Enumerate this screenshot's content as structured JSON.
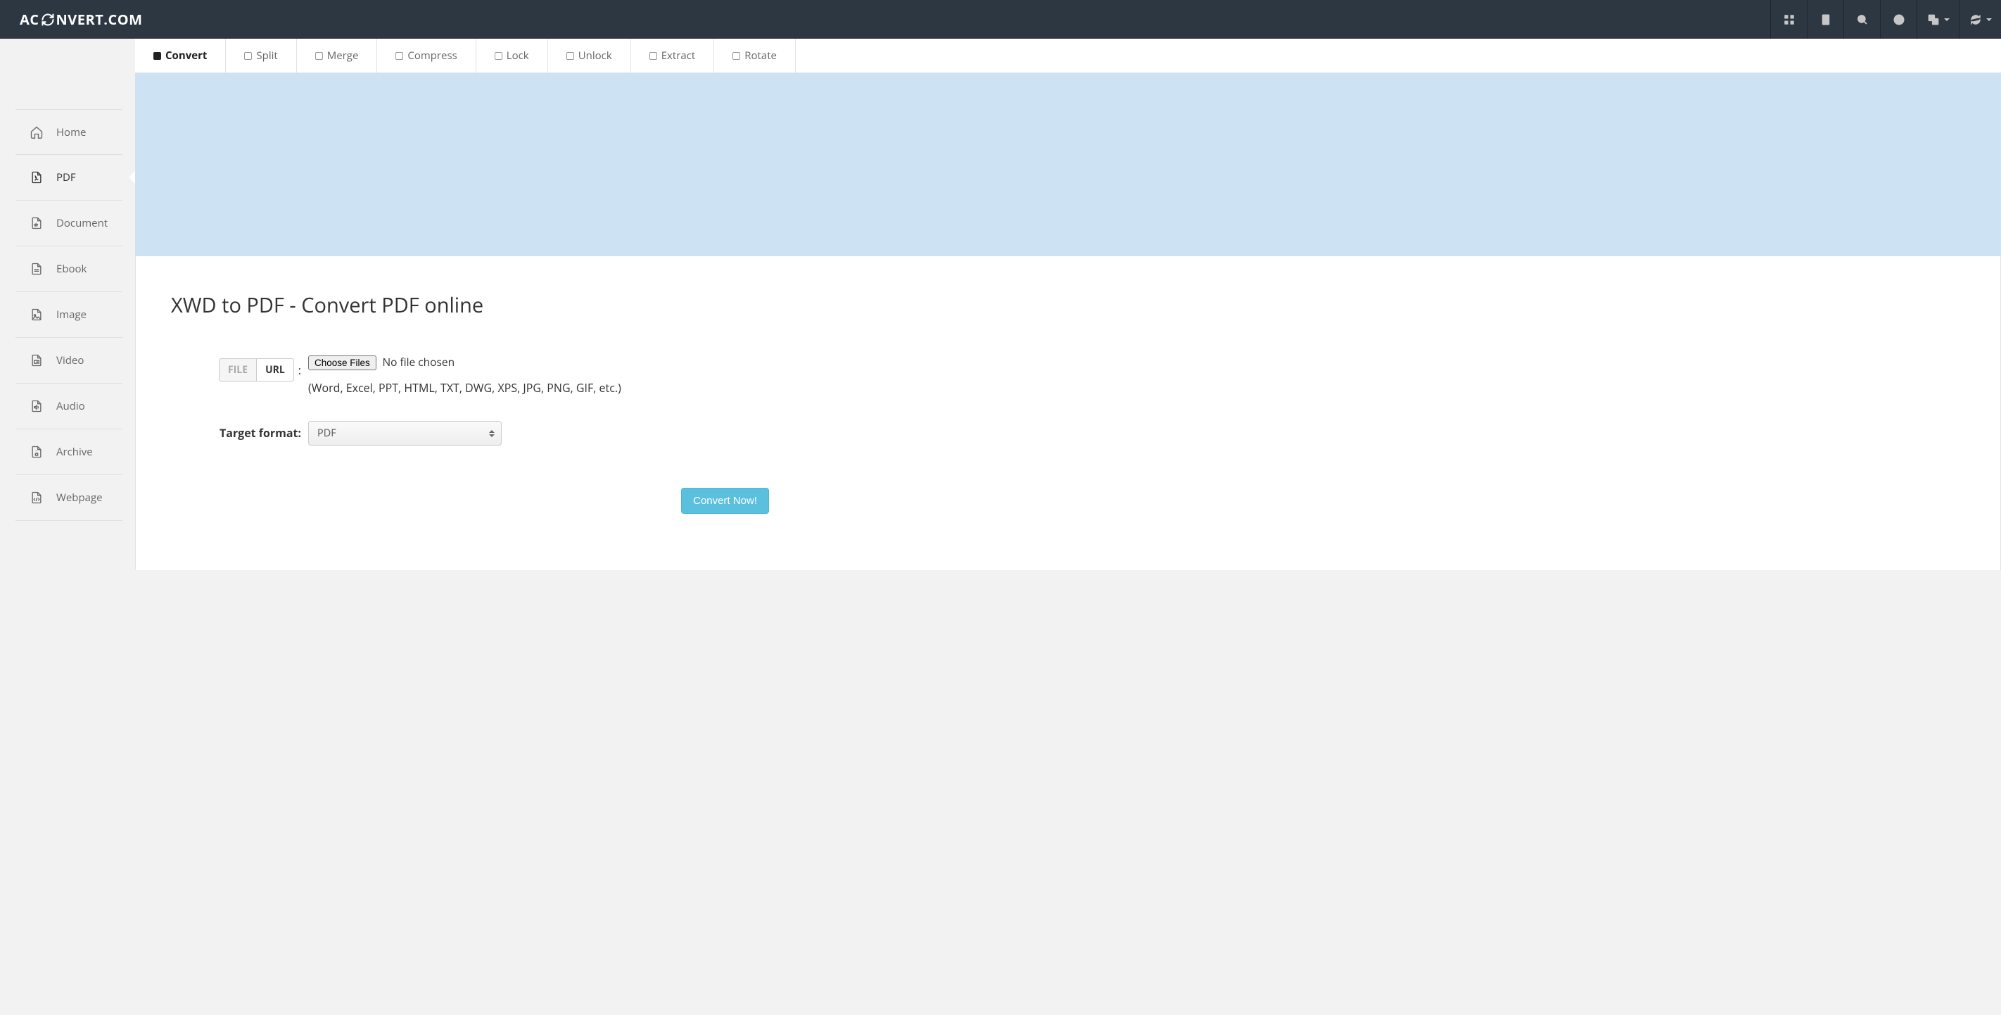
{
  "header": {
    "logo_pre": "AC",
    "logo_post": "NVERT.COM"
  },
  "sidebar": {
    "items": [
      {
        "label": "Home"
      },
      {
        "label": "PDF"
      },
      {
        "label": "Document"
      },
      {
        "label": "Ebook"
      },
      {
        "label": "Image"
      },
      {
        "label": "Video"
      },
      {
        "label": "Audio"
      },
      {
        "label": "Archive"
      },
      {
        "label": "Webpage"
      }
    ]
  },
  "tabs": [
    {
      "label": "Convert"
    },
    {
      "label": "Split"
    },
    {
      "label": "Merge"
    },
    {
      "label": "Compress"
    },
    {
      "label": "Lock"
    },
    {
      "label": "Unlock"
    },
    {
      "label": "Extract"
    },
    {
      "label": "Rotate"
    }
  ],
  "page": {
    "title": "XWD to PDF - Convert PDF online"
  },
  "form": {
    "source_toggle_file": "FILE",
    "source_toggle_url": "URL",
    "source_colon": ":",
    "choose_files_btn": "Choose Files",
    "no_file_text": "No file chosen",
    "file_hint": "(Word, Excel, PPT, HTML, TXT, DWG, XPS, JPG, PNG, GIF, etc.)",
    "target_label": "Target format:",
    "target_value": "PDF",
    "convert_btn": "Convert Now!"
  }
}
